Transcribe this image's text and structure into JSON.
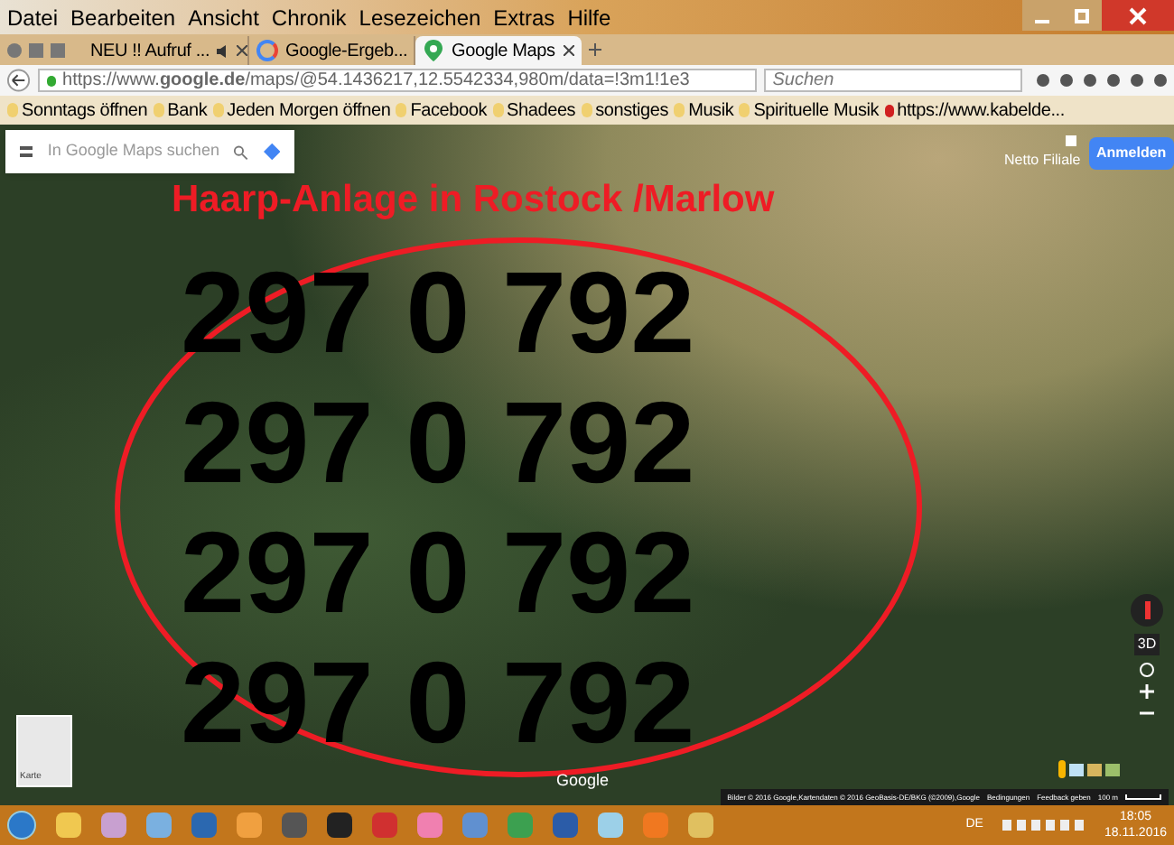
{
  "menu": [
    "Datei",
    "Bearbeiten",
    "Ansicht",
    "Chronik",
    "Lesezeichen",
    "Extras",
    "Hilfe"
  ],
  "tabs": [
    {
      "label": "NEU !! Aufruf ...",
      "selected": false,
      "kind": "audio"
    },
    {
      "label": "Google-Ergeb...",
      "selected": false,
      "kind": "search"
    },
    {
      "label": "Google Maps",
      "selected": true,
      "kind": "maps"
    }
  ],
  "address": {
    "url": "https://www.**google.de**/maps/@54.1436217,12.5542334,980m/data=!3m1!1e3",
    "search_placeholder": "Suchen"
  },
  "bookmarks": [
    {
      "label": "Sonntags öffnen",
      "kind": "folder"
    },
    {
      "label": "Bank",
      "kind": "folder"
    },
    {
      "label": "Jeden Morgen öffnen",
      "kind": "folder"
    },
    {
      "label": "Facebook",
      "kind": "folder"
    },
    {
      "label": "Shadees",
      "kind": "folder"
    },
    {
      "label": "sonstiges",
      "kind": "folder"
    },
    {
      "label": "Musik",
      "kind": "folder"
    },
    {
      "label": "Spirituelle Musik",
      "kind": "folder"
    },
    {
      "label": "https://www.kabelde...",
      "kind": "link"
    }
  ],
  "map": {
    "search_placeholder": "In Google Maps suchen",
    "sign_in": "Anmelden",
    "place_label": "Netto Filiale",
    "overlay_title": "Haarp-Anlage in Rostock /Marlow",
    "numbers": [
      "297 0 792",
      "297 0 792",
      "297 0 792",
      "297 0 792"
    ],
    "tilt_button": "3D",
    "layer_label": "Karte",
    "logo": "Google",
    "attribution": "Bilder © 2016 Google,Kartendaten © 2016 GeoBasis-DE/BKG (©2009),Google",
    "terms": "Bedingungen",
    "feedback": "Feedback geben",
    "scale": "100 m"
  },
  "taskbar": {
    "language": "DE",
    "time": "18:05",
    "date": "18.11.2016"
  }
}
